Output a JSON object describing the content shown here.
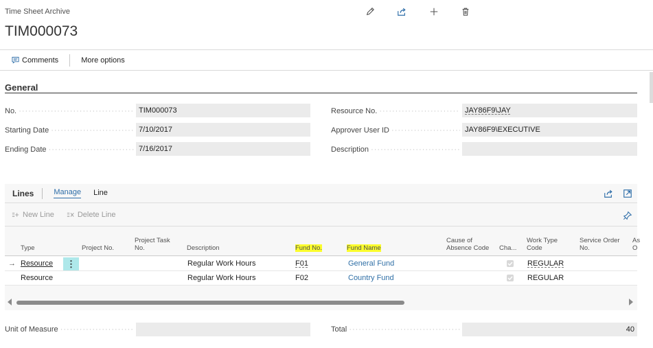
{
  "header": {
    "breadcrumb": "Time Sheet Archive",
    "title": "TIM000073",
    "icons": [
      "edit-icon",
      "share-icon",
      "add-icon",
      "delete-icon"
    ]
  },
  "actionbar": {
    "comments": "Comments",
    "more_options": "More options"
  },
  "general": {
    "section_title": "General",
    "fields_left": [
      {
        "label": "No.",
        "value": "TIM000073"
      },
      {
        "label": "Starting Date",
        "value": "7/10/2017"
      },
      {
        "label": "Ending Date",
        "value": "7/16/2017"
      }
    ],
    "fields_right": [
      {
        "label": "Resource No.",
        "value": "JAY86F9\\JAY"
      },
      {
        "label": "Approver User ID",
        "value": "JAY86F9\\EXECUTIVE"
      },
      {
        "label": "Description",
        "value": ""
      }
    ]
  },
  "lines": {
    "title": "Lines",
    "tabs": [
      "Manage",
      "Line"
    ],
    "actions": {
      "new_line": "New Line",
      "delete_line": "Delete Line"
    },
    "columns": {
      "type": "Type",
      "project_no": "Project No.",
      "project_task_no_1": "Project Task",
      "project_task_no_2": "No.",
      "description": "Description",
      "fund_no": "Fund No.",
      "fund_name": "Fund Name",
      "cause_absence_1": "Cause of",
      "cause_absence_2": "Absence Code",
      "chargeable": "Cha...",
      "work_type_1": "Work Type",
      "work_type_2": "Code",
      "service_order_1": "Service Order",
      "service_order_2": "No.",
      "extra_1": "As",
      "extra_2": "O"
    },
    "rows": [
      {
        "type": "Resource",
        "description": "Regular Work Hours",
        "fund_no": "F01",
        "fund_name": "General Fund",
        "chargeable": true,
        "work_type": "REGULAR"
      },
      {
        "type": "Resource",
        "description": "Regular Work Hours",
        "fund_no": "F02",
        "fund_name": "Country Fund",
        "chargeable": true,
        "work_type": "REGULAR"
      }
    ]
  },
  "footer": {
    "unit_of_measure_label": "Unit of Measure",
    "unit_of_measure_value": "",
    "total_label": "Total",
    "total_value": "40"
  },
  "colors": {
    "link": "#2f6fa6",
    "highlight": "#fbfd2c",
    "row_menu": "#aee8ea",
    "field_bg": "#ebebeb"
  }
}
